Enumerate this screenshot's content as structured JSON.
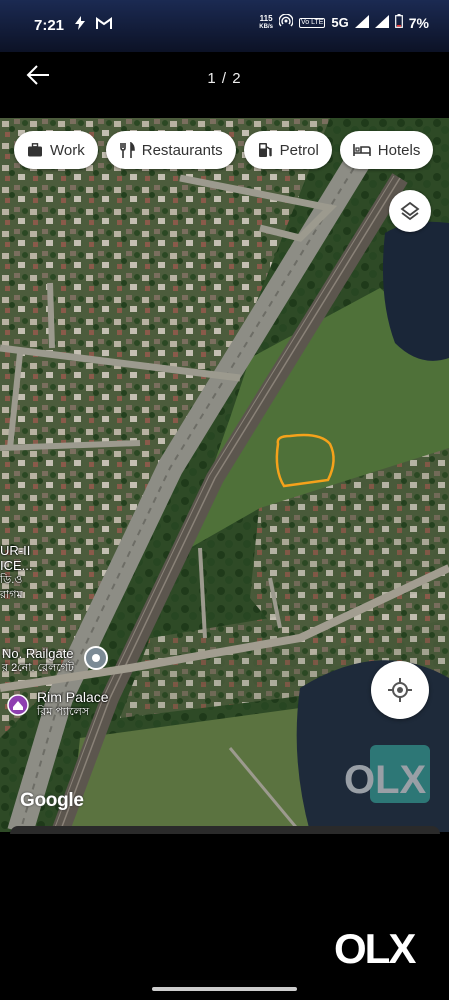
{
  "status_bar": {
    "time": "7:21",
    "net_speed_value": "115",
    "net_speed_unit": "KB/s",
    "volte": "Vo LTE",
    "network": "5G",
    "battery": "7%"
  },
  "viewer": {
    "pager": "1 / 2"
  },
  "map": {
    "chips": [
      {
        "label": "Work",
        "icon": "briefcase-icon"
      },
      {
        "label": "Restaurants",
        "icon": "fork-knife-icon"
      },
      {
        "label": "Petrol",
        "icon": "fuel-pump-icon"
      },
      {
        "label": "Hotels",
        "icon": "bed-icon"
      }
    ],
    "labels": {
      "area_line1": "UR-II",
      "area_line2": "ICE...",
      "area_line3": "ডি.ও",
      "area_line4": "রাগম",
      "railgate": "No. Railgate",
      "railgate_bn": "র 2নো. রেলগেট",
      "poi_name": "Rim Palace",
      "poi_name_bn": "রিম প্যালেস"
    },
    "attribution": "Google",
    "watermark": "OLX",
    "colors": {
      "marker_orange": "#f5a21b",
      "poi_purple": "#8e3fb0"
    }
  },
  "brand": {
    "logo_text": "OLX"
  }
}
